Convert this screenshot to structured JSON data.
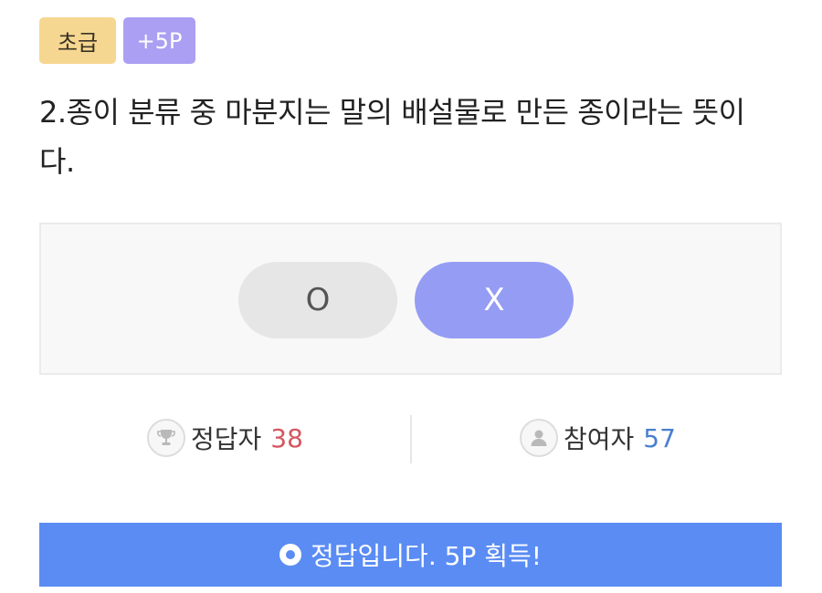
{
  "badges": {
    "level": "초급",
    "points": "+5P"
  },
  "question": {
    "text": "2.종이 분류 중 마분지는 말의 배설물로 만든 종이라는 뜻이다."
  },
  "options": {
    "o": "O",
    "x": "X",
    "selected": "X"
  },
  "stats": {
    "correct_label": "정답자",
    "correct_count": "38",
    "participants_label": "참여자",
    "participants_count": "57"
  },
  "result": {
    "message": "정답입니다. 5P 획득!"
  },
  "icons": {
    "correct": "trophy-icon",
    "participants": "person-icon",
    "result": "circle-o-icon"
  },
  "colors": {
    "level_badge": "#f6d791",
    "points_badge": "#ab9ff3",
    "selected_option": "#959cf4",
    "result_bar": "#5a8cf3",
    "correct_count": "#d5565f",
    "participants_count": "#4a7fcf"
  }
}
